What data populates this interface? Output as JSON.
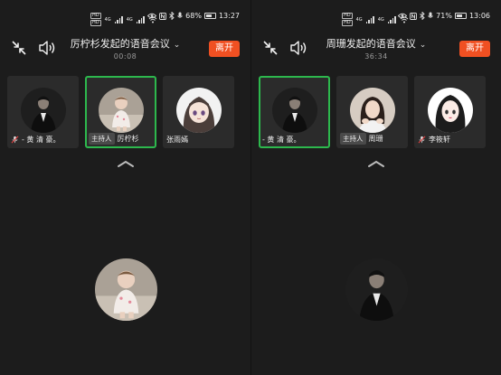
{
  "screens": [
    {
      "status": {
        "hd1": "HD",
        "hd2": "HD",
        "sig1": "4G",
        "sig2": "4G",
        "battery_pct": "68%",
        "battery_level": 0.68,
        "time": "13:27"
      },
      "header": {
        "title": "厉柠杉发起的语音会议",
        "timer": "00:08",
        "leave_label": "离开"
      },
      "tiles": [
        {
          "name": "- 黄 清 豪。",
          "host": "",
          "muted": true,
          "active": false,
          "avatar": "man-dark"
        },
        {
          "name": "厉柠杉",
          "host": "主持人",
          "muted": false,
          "active": true,
          "avatar": "baby"
        },
        {
          "name": "张雨嫣",
          "host": "",
          "muted": false,
          "active": false,
          "avatar": "anime-girl"
        }
      ],
      "main_avatar": "baby"
    },
    {
      "status": {
        "hd1": "HD",
        "hd2": "HD",
        "sig1": "4G",
        "sig2": "4G",
        "battery_pct": "71%",
        "battery_level": 0.71,
        "time": "13:06"
      },
      "header": {
        "title": "周珊发起的语音会议",
        "timer": "36:34",
        "leave_label": "离开"
      },
      "tiles": [
        {
          "name": "- 黄 清 豪。",
          "host": "",
          "muted": false,
          "active": true,
          "avatar": "man-dark"
        },
        {
          "name": "周珊",
          "host": "主持人",
          "muted": false,
          "active": false,
          "avatar": "girl"
        },
        {
          "name": "李筱轩",
          "host": "",
          "muted": true,
          "active": false,
          "avatar": "anime-girl-2"
        }
      ],
      "main_avatar": "man-dark"
    }
  ],
  "colors": {
    "leave": "#f05022",
    "active_border": "#2db84d",
    "tile_bg": "#2b2b2b",
    "bg": "#1c1c1c"
  },
  "icons": [
    "collapse-icon",
    "speaker-icon",
    "chevron-down-icon",
    "mute-icon",
    "pull-up-handle-icon",
    "wifi-icon",
    "eye-icon",
    "nfc-icon",
    "bluetooth-icon",
    "mic-icon",
    "battery-icon"
  ]
}
